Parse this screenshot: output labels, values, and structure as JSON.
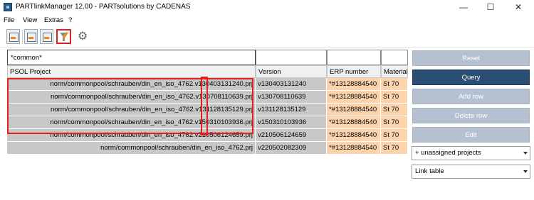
{
  "window": {
    "title": "PARTlinkManager 12.00 - PARTsolutions by CADENAS",
    "minimize_glyph": "—",
    "maximize_glyph": "☐",
    "close_glyph": "✕"
  },
  "menu": [
    "File",
    "View",
    "Extras",
    "?"
  ],
  "toolbar": {
    "icons": [
      "project-view-icon",
      "export-icon",
      "import-icon",
      "filter-clear-icon",
      "settings-gear-icon"
    ],
    "gear_glyph": "⚙"
  },
  "filter": {
    "project_value": "*common*"
  },
  "table": {
    "columns": [
      "PSOL Project",
      "Version",
      "ERP number",
      "Material"
    ],
    "rows": [
      {
        "project": "norm/commonpool/schrauben/din_en_iso_4762.v130403131240.prj",
        "version": "v130403131240",
        "erp": "*#13128884540",
        "material": "St 70"
      },
      {
        "project": "norm/commonpool/schrauben/din_en_iso_4762.v130708110639.prj",
        "version": "v130708110639",
        "erp": "*#13128884540",
        "material": "St 70"
      },
      {
        "project": "norm/commonpool/schrauben/din_en_iso_4762.v131128135129.prj",
        "version": "v131128135129",
        "erp": "*#13128884540",
        "material": "St 70"
      },
      {
        "project": "norm/commonpool/schrauben/din_en_iso_4762.v150310103936.prj",
        "version": "v150310103936",
        "erp": "*#13128884540",
        "material": "St 70"
      },
      {
        "project": "norm/commonpool/schrauben/din_en_iso_4762.v210506124659.prj",
        "version": "v210506124659",
        "erp": "*#13128884540",
        "material": "St 70"
      },
      {
        "project": "norm/commonpool/schrauben/din_en_iso_4762.prj",
        "version": "v220502082309",
        "erp": "*#13128884540",
        "material": "St 70"
      }
    ]
  },
  "side_panel": {
    "reset": "Reset",
    "query": "Query",
    "add_row": "Add row",
    "delete_row": "Delete row",
    "edit": "Edit",
    "project_filter": "+ unassigned projects",
    "table_select": "Link table"
  },
  "colors": {
    "query_button": "#2b4f73",
    "disabled_button": "#b5c1d0",
    "erp_cell": "#fbd3ad",
    "grey_cell": "#c8c8c8",
    "highlight": "#e02020"
  }
}
